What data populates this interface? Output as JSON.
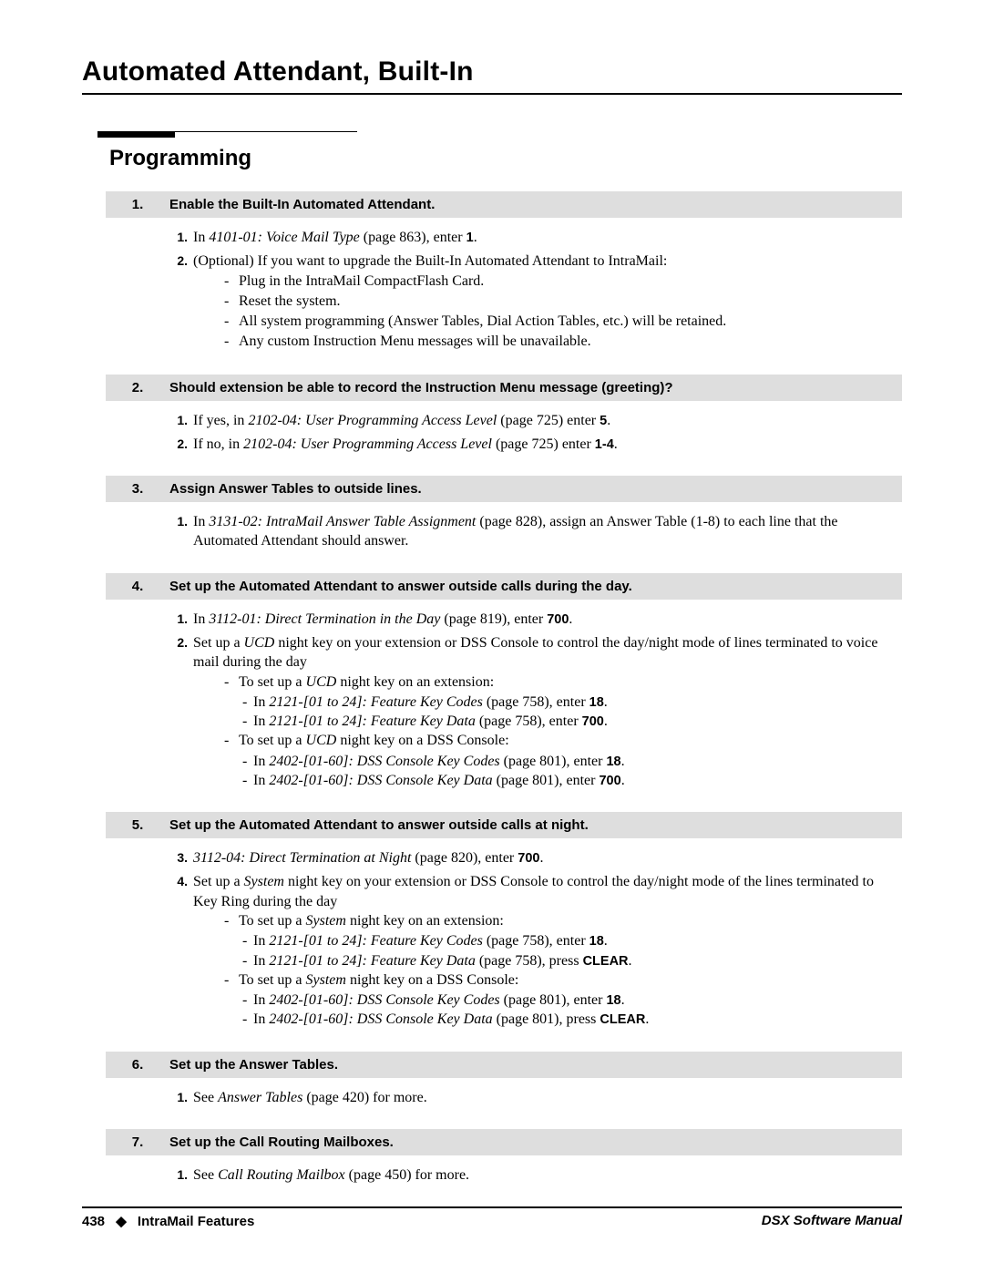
{
  "title": "Automated Attendant, Built-In",
  "section": "Programming",
  "steps": [
    {
      "num": "1.",
      "label": "Enable the Built-In Automated Attendant.",
      "items": [
        {
          "n": "1.",
          "parts": [
            "In ",
            {
              "i": "4101-01: Voice Mail Type"
            },
            " (page 863), enter ",
            {
              "b": "1"
            },
            "."
          ]
        },
        {
          "n": "2.",
          "parts": [
            "(Optional) If you want to upgrade the Built-In Automated Attendant to IntraMail:"
          ],
          "sub": [
            [
              "Plug in the IntraMail CompactFlash Card."
            ],
            [
              "Reset the system."
            ],
            [
              "All system programming (Answer Tables, Dial Action Tables, etc.) will be retained."
            ],
            [
              "Any custom Instruction Menu messages will be unavailable."
            ]
          ]
        }
      ]
    },
    {
      "num": "2.",
      "label": "Should extension be able to record the Instruction Menu message (greeting)?",
      "items": [
        {
          "n": "1.",
          "parts": [
            "If yes, in ",
            {
              "i": "2102-04: User Programming Access Level"
            },
            " (page 725) enter ",
            {
              "b": "5"
            },
            "."
          ]
        },
        {
          "n": "2.",
          "parts": [
            "If no, in ",
            {
              "i": "2102-04: User Programming Access Level"
            },
            " (page 725) enter ",
            {
              "b": "1-4"
            },
            "."
          ]
        }
      ]
    },
    {
      "num": "3.",
      "label": "Assign Answer Tables to outside lines.",
      "items": [
        {
          "n": "1.",
          "parts": [
            "In ",
            {
              "i": "3131-02: IntraMail Answer Table Assignment"
            },
            " (page 828), assign an Answer Table (1-8) to each line that the Automated Attendant should answer."
          ]
        }
      ]
    },
    {
      "num": "4.",
      "label": "Set up the Automated Attendant to answer outside calls during the day.",
      "items": [
        {
          "n": "1.",
          "parts": [
            "In ",
            {
              "i": "3112-01: Direct Termination in the Day"
            },
            " (page 819), enter ",
            {
              "b": "700"
            },
            "."
          ]
        },
        {
          "n": "2.",
          "parts": [
            "Set up a ",
            {
              "i": "UCD"
            },
            " night key on your extension or DSS Console to control the day/night mode of lines terminated to voice mail during the day"
          ],
          "sub": [
            [
              "To set up a ",
              {
                "i": "UCD"
              },
              " night key on an extension:"
            ],
            {
              "sub2": [
                [
                  "In ",
                  {
                    "i": "2121-[01 to 24]: Feature Key Codes"
                  },
                  " (page 758), enter ",
                  {
                    "b": "18"
                  },
                  "."
                ],
                [
                  "In ",
                  {
                    "i": "2121-[01 to 24]: Feature Key Data"
                  },
                  " (page 758), enter ",
                  {
                    "b": "700"
                  },
                  "."
                ]
              ]
            },
            [
              "To set up a ",
              {
                "i": "UCD"
              },
              " night key on a DSS Console:"
            ],
            {
              "sub2": [
                [
                  "In ",
                  {
                    "i": "2402-[01-60]: DSS Console Key Codes"
                  },
                  " (page 801), enter ",
                  {
                    "b": "18"
                  },
                  "."
                ],
                [
                  "In ",
                  {
                    "i": "2402-[01-60]: DSS Console Key Data"
                  },
                  " (page 801), enter ",
                  {
                    "b": "700"
                  },
                  "."
                ]
              ]
            }
          ]
        }
      ]
    },
    {
      "num": "5.",
      "label": "Set up the Automated Attendant to answer outside calls at night.",
      "items": [
        {
          "n": "3.",
          "parts": [
            {
              "i": "3112-04: Direct Termination at Night"
            },
            " (page 820), enter ",
            {
              "b": "700"
            },
            "."
          ]
        },
        {
          "n": "4.",
          "parts": [
            "Set up a ",
            {
              "i": "System"
            },
            " night key on your extension or DSS Console to control the day/night mode of the lines terminated to Key Ring during the day"
          ],
          "sub": [
            [
              "To set up a ",
              {
                "i": "System"
              },
              " night key on an extension:"
            ],
            {
              "sub2": [
                [
                  "In ",
                  {
                    "i": "2121-[01 to 24]: Feature Key Codes"
                  },
                  " (page 758), enter ",
                  {
                    "b": "18"
                  },
                  "."
                ],
                [
                  "In ",
                  {
                    "i": "2121-[01 to 24]: Feature Key Data"
                  },
                  " (page 758), press ",
                  {
                    "b": "CLEAR"
                  },
                  "."
                ]
              ]
            },
            [
              "To set up a ",
              {
                "i": "System"
              },
              " night key on a DSS Console:"
            ],
            {
              "sub2": [
                [
                  "In ",
                  {
                    "i": "2402-[01-60]: DSS Console Key Codes"
                  },
                  " (page 801), enter ",
                  {
                    "b": "18"
                  },
                  "."
                ],
                [
                  "In ",
                  {
                    "i": "2402-[01-60]: DSS Console Key Data"
                  },
                  " (page 801), press ",
                  {
                    "b": "CLEAR"
                  },
                  "."
                ]
              ]
            }
          ]
        }
      ]
    },
    {
      "num": "6.",
      "label": "Set up the Answer Tables.",
      "items": [
        {
          "n": "1.",
          "parts": [
            "See ",
            {
              "i": "Answer Tables"
            },
            " (page 420) for more."
          ]
        }
      ]
    },
    {
      "num": "7.",
      "label": "Set up the Call Routing Mailboxes.",
      "items": [
        {
          "n": "1.",
          "parts": [
            "See ",
            {
              "i": "Call Routing Mailbox"
            },
            " (page 450) for more."
          ]
        }
      ]
    }
  ],
  "footer": {
    "page": "438",
    "diamond": "◆",
    "label": "IntraMail Features",
    "right": "DSX Software Manual"
  }
}
